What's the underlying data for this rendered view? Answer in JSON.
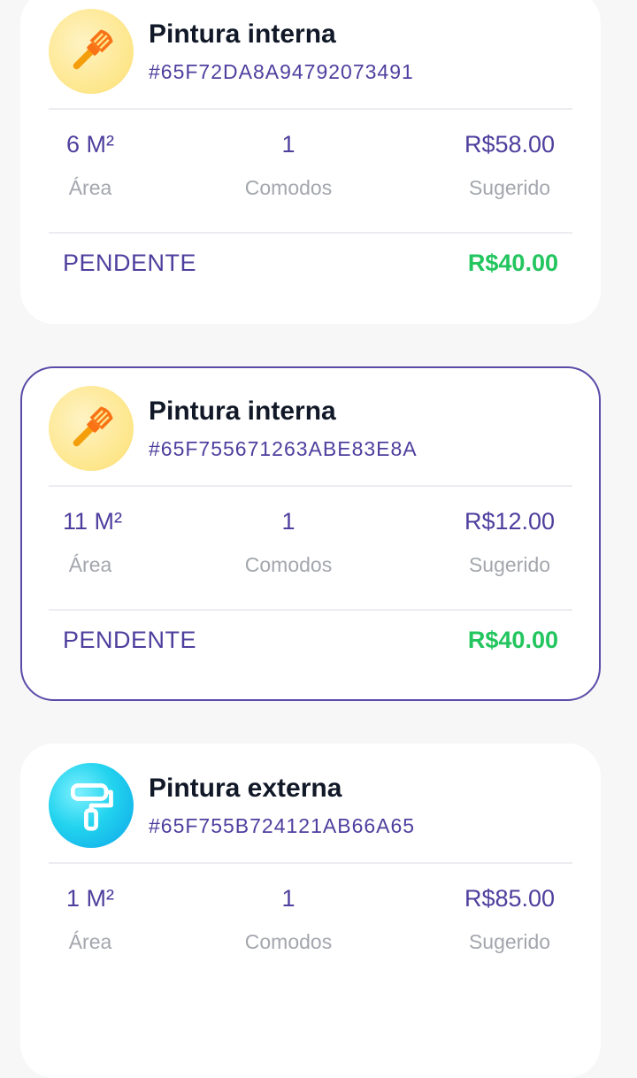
{
  "services": [
    {
      "title": "Pintura interna",
      "code": "#65F72DA8A94792073491",
      "icon": "paint-brush-icon",
      "area": "6 M²",
      "area_label": "Área",
      "rooms": "1",
      "rooms_label": "Comodos",
      "suggested": "R$58.00",
      "suggested_label": "Sugerido",
      "status": "PENDENTE",
      "price": "R$40.00",
      "selected": false
    },
    {
      "title": "Pintura interna",
      "code": "#65F755671263ABE83E8A",
      "icon": "paint-brush-icon",
      "area": "11 M²",
      "area_label": "Área",
      "rooms": "1",
      "rooms_label": "Comodos",
      "suggested": "R$12.00",
      "suggested_label": "Sugerido",
      "status": "PENDENTE",
      "price": "R$40.00",
      "selected": true
    },
    {
      "title": "Pintura externa",
      "code": "#65F755B724121AB66A65",
      "icon": "paint-roller-icon",
      "area": "1 M²",
      "area_label": "Área",
      "rooms": "1",
      "rooms_label": "Comodos",
      "suggested": "R$85.00",
      "suggested_label": "Sugerido"
    }
  ],
  "colors": {
    "accent": "#4e3f9e",
    "price_green": "#22c55e",
    "label_gray": "#a3a6ad",
    "background": "#f7f7f7"
  }
}
